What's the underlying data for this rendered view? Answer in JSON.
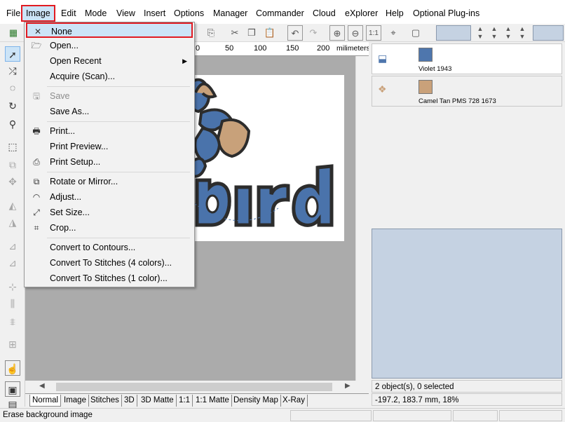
{
  "menubar": {
    "items": [
      "File",
      "Image",
      "Edit",
      "Mode",
      "View",
      "Insert",
      "Options",
      "Manager",
      "Commander",
      "Cloud",
      "eXplorer",
      "Help",
      "Optional Plug-ins"
    ]
  },
  "image_menu": {
    "items": [
      {
        "label": "None",
        "icon": "x-icon",
        "enabled": true,
        "highlighted": true
      },
      {
        "label": "Open...",
        "icon": "open-folder-icon",
        "enabled": true
      },
      {
        "label": "Open Recent",
        "icon": "",
        "enabled": true,
        "submenu": true
      },
      {
        "label": "Acquire (Scan)...",
        "icon": "",
        "enabled": true
      },
      {
        "label": "Save",
        "icon": "save-icon",
        "enabled": false
      },
      {
        "label": "Save As...",
        "icon": "",
        "enabled": true
      },
      {
        "label": "Print...",
        "icon": "printer-icon",
        "enabled": true
      },
      {
        "label": "Print Preview...",
        "icon": "",
        "enabled": true
      },
      {
        "label": "Print Setup...",
        "icon": "print-setup-icon",
        "enabled": true
      },
      {
        "label": "Rotate or Mirror...",
        "icon": "rotate-mirror-icon",
        "enabled": true
      },
      {
        "label": "Adjust...",
        "icon": "adjust-gauge-icon",
        "enabled": true
      },
      {
        "label": "Set Size...",
        "icon": "resize-arrows-icon",
        "enabled": true
      },
      {
        "label": "Crop...",
        "icon": "crop-icon",
        "enabled": true
      },
      {
        "label": "Convert to Contours...",
        "icon": "",
        "enabled": true
      },
      {
        "label": "Convert To Stitches (4 colors)...",
        "icon": "",
        "enabled": true
      },
      {
        "label": "Convert To Stitches (1 color)...",
        "icon": "",
        "enabled": true
      }
    ]
  },
  "ruler": {
    "labels": [
      "0",
      "50",
      "100",
      "150",
      "200"
    ],
    "unit": "milimeters"
  },
  "canvas": {
    "art_text": "bird",
    "colors": {
      "blue": "#4a73ab",
      "tan": "#c8a17a",
      "outline": "#2c2c2c",
      "canvas_bg": "#ababab"
    }
  },
  "thread_palette": [
    {
      "name": "Violet 1943",
      "color": "#4e76ad"
    },
    {
      "name": "Camel Tan PMS 728 1673",
      "color": "#c9a17a"
    }
  ],
  "right_panel": {
    "selection_info": "2 object(s), 0 selected",
    "coords": "-197.2, 183.7 mm, 18%"
  },
  "view_tabs": [
    "Normal",
    "Image",
    "Stitches",
    "3D",
    "3D Matte",
    "1:1",
    "1:1 Matte",
    "Density Map",
    "X-Ray"
  ],
  "status_bar": {
    "text": "Erase background image"
  }
}
